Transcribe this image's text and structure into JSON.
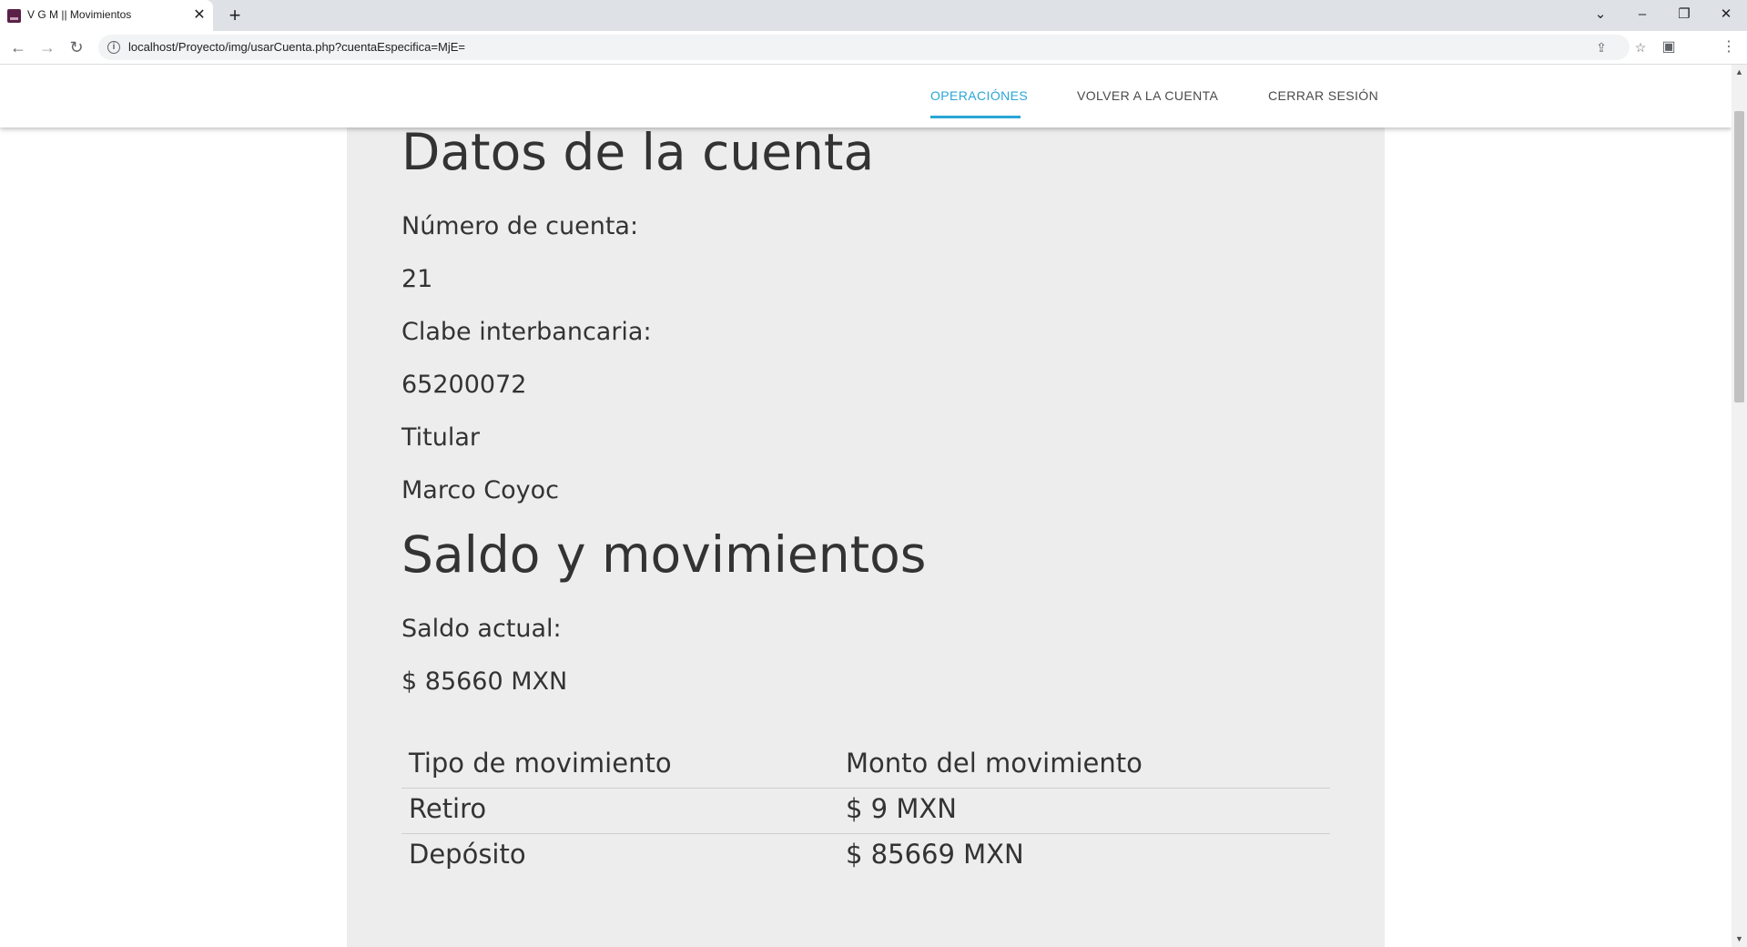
{
  "browser": {
    "tab_title": "V G M || Movimientos",
    "tab_close_glyph": "✕",
    "new_tab_glyph": "+",
    "url": "localhost/Proyecto/img/usarCuenta.php?cuentaEspecifica=MjE=",
    "window_buttons": {
      "tabsearch": "⌄",
      "minimize": "–",
      "restore": "❐",
      "close": "✕"
    },
    "nav_icons": {
      "back": "←",
      "forward": "→",
      "reload": "↻"
    }
  },
  "header": {
    "nav": [
      {
        "label": "OPERACIÓNES",
        "active": true
      },
      {
        "label": "VOLVER A LA CUENTA",
        "active": false
      },
      {
        "label": "CERRAR SESIÓN",
        "active": false
      }
    ],
    "accent_color": "#2aa6d6"
  },
  "account": {
    "title": "Datos de la cuenta",
    "number_label": "Número de cuenta:",
    "number_value": "21",
    "clabe_label": "Clabe interbancaria:",
    "clabe_value": "65200072",
    "holder_label": "Titular",
    "holder_value": "Marco Coyoc"
  },
  "balance": {
    "title": "Saldo y movimientos",
    "current_label": "Saldo actual:",
    "current_value": "$ 85660 MXN"
  },
  "movements": {
    "headers": [
      "Tipo de movimiento",
      "Monto del movimiento"
    ],
    "rows": [
      [
        "Retiro",
        "$ 9 MXN"
      ],
      [
        "Depósito",
        "$ 85669 MXN"
      ]
    ]
  }
}
